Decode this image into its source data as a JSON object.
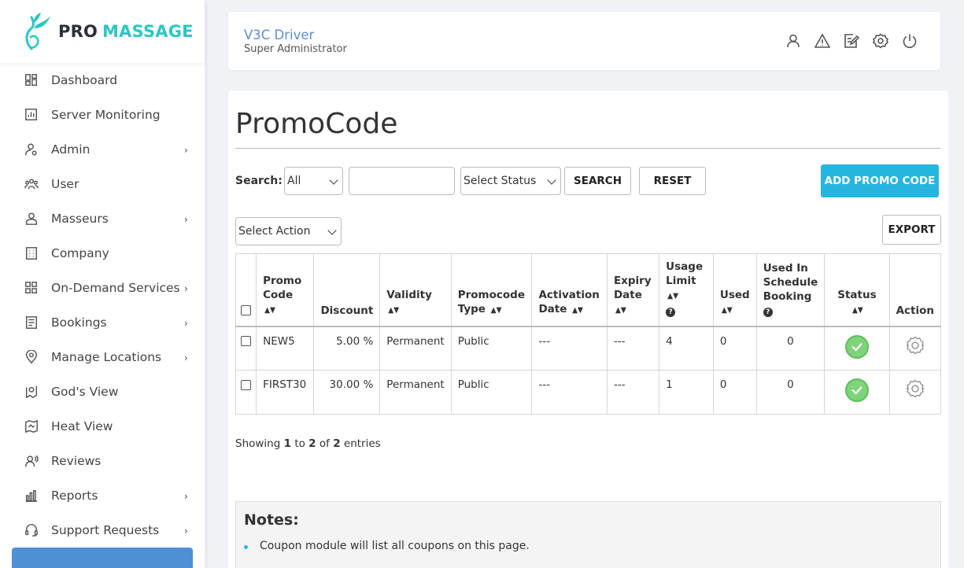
{
  "brand": {
    "name_part1": "PRO",
    "name_part2": "MASSAGE"
  },
  "sidebar": {
    "items": [
      {
        "label": "Dashboard",
        "icon": "dashboard-icon",
        "has_submenu": false
      },
      {
        "label": "Server Monitoring",
        "icon": "monitor-chart-icon",
        "has_submenu": false
      },
      {
        "label": "Admin",
        "icon": "admin-user-icon",
        "has_submenu": true
      },
      {
        "label": "User",
        "icon": "users-icon",
        "has_submenu": false
      },
      {
        "label": "Masseurs",
        "icon": "person-icon",
        "has_submenu": true
      },
      {
        "label": "Company",
        "icon": "building-icon",
        "has_submenu": false
      },
      {
        "label": "On-Demand Services",
        "icon": "grid-icon",
        "has_submenu": true
      },
      {
        "label": "Bookings",
        "icon": "list-doc-icon",
        "has_submenu": true
      },
      {
        "label": "Manage Locations",
        "icon": "location-pin-icon",
        "has_submenu": true
      },
      {
        "label": "God's View",
        "icon": "map-eye-icon",
        "has_submenu": false
      },
      {
        "label": "Heat View",
        "icon": "heat-map-icon",
        "has_submenu": false
      },
      {
        "label": "Reviews",
        "icon": "review-voice-icon",
        "has_submenu": false
      },
      {
        "label": "Reports",
        "icon": "bar-chart-icon",
        "has_submenu": true
      },
      {
        "label": "Support Requests",
        "icon": "headset-icon",
        "has_submenu": true
      }
    ]
  },
  "header": {
    "user_name": "V3C Driver",
    "user_role": "Super Administrator",
    "icons": [
      "profile-icon",
      "alert-icon",
      "edit-note-icon",
      "settings-icon",
      "power-icon"
    ]
  },
  "page": {
    "title": "PromoCode",
    "search_label": "Search:",
    "search_field_option": "All",
    "search_input_value": "",
    "status_select": "Select Status",
    "search_button": "SEARCH",
    "reset_button": "RESET",
    "add_button": "ADD PROMO CODE",
    "action_select": "Select Action",
    "export_button": "EXPORT"
  },
  "table": {
    "headers": {
      "promo_code_1": "Promo",
      "promo_code_2": "Code",
      "discount": "Discount",
      "validity": "Validity",
      "type_1": "Promocode",
      "type_2": "Type",
      "activation_1": "Activation",
      "activation_2": "Date",
      "expiry_1": "Expiry",
      "expiry_2": "Date",
      "usage_1": "Usage",
      "usage_2": "Limit",
      "used": "Used",
      "schedule_1": "Used In",
      "schedule_2": "Schedule",
      "schedule_3": "Booking",
      "status": "Status",
      "action": "Action"
    },
    "rows": [
      {
        "code": "NEW5",
        "discount": "5.00 %",
        "validity": "Permanent",
        "type": "Public",
        "activation": "---",
        "expiry": "---",
        "usage_limit": "4",
        "used": "0",
        "used_schedule": "0",
        "status": "active"
      },
      {
        "code": "FIRST30",
        "discount": "30.00 %",
        "validity": "Permanent",
        "type": "Public",
        "activation": "---",
        "expiry": "---",
        "usage_limit": "1",
        "used": "0",
        "used_schedule": "0",
        "status": "active"
      }
    ]
  },
  "footer_info": {
    "prefix": "Showing",
    "from": "1",
    "to_word": "to",
    "to": "2",
    "of_word": "of",
    "total": "2",
    "suffix": "entries"
  },
  "notes": {
    "title": "Notes:",
    "items": [
      "Coupon module will list all coupons on this page."
    ]
  },
  "colors": {
    "accent": "#26b5e0",
    "brand_teal": "#2bc7c2",
    "user_name": "#5b8ed0",
    "status_ok": "#7fd37b"
  }
}
